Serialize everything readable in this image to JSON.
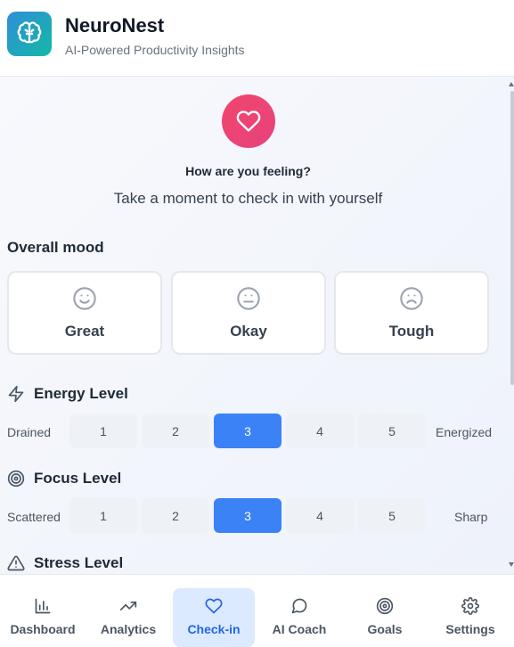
{
  "app": {
    "title": "NeuroNest",
    "subtitle": "AI-Powered Productivity Insights",
    "logo_icon": "brain-icon",
    "accent_gradient": [
      "#2f8fd8",
      "#14b8a6"
    ]
  },
  "checkin": {
    "icon": "heart-icon",
    "title": "How are you feeling?",
    "subtitle": "Take a moment to check in with yourself"
  },
  "mood": {
    "title": "Overall mood",
    "options": [
      {
        "label": "Great",
        "icon": "smile-icon"
      },
      {
        "label": "Okay",
        "icon": "neutral-face-icon"
      },
      {
        "label": "Tough",
        "icon": "frown-icon"
      }
    ]
  },
  "energy": {
    "title": "Energy Level",
    "icon": "lightning-icon",
    "low_label": "Drained",
    "high_label": "Energized",
    "options": [
      "1",
      "2",
      "3",
      "4",
      "5"
    ],
    "selected": "3"
  },
  "focus": {
    "title": "Focus Level",
    "icon": "target-icon",
    "low_label": "Scattered",
    "high_label": "Sharp",
    "options": [
      "1",
      "2",
      "3",
      "4",
      "5"
    ],
    "selected": "3"
  },
  "stress": {
    "title": "Stress Level",
    "icon": "warning-triangle-icon"
  },
  "nav": {
    "items": [
      {
        "label": "Dashboard",
        "icon": "bar-chart-icon"
      },
      {
        "label": "Analytics",
        "icon": "trending-up-icon"
      },
      {
        "label": "Check-in",
        "icon": "heart-icon"
      },
      {
        "label": "AI Coach",
        "icon": "chat-bubble-icon"
      },
      {
        "label": "Goals",
        "icon": "target-icon"
      },
      {
        "label": "Settings",
        "icon": "gear-icon"
      }
    ],
    "active": "Check-in"
  },
  "colors": {
    "selected": "#3b82f6",
    "heart_badge": "#f0466b",
    "active_nav_bg": "#dbeafe",
    "active_nav_text": "#2563eb"
  }
}
